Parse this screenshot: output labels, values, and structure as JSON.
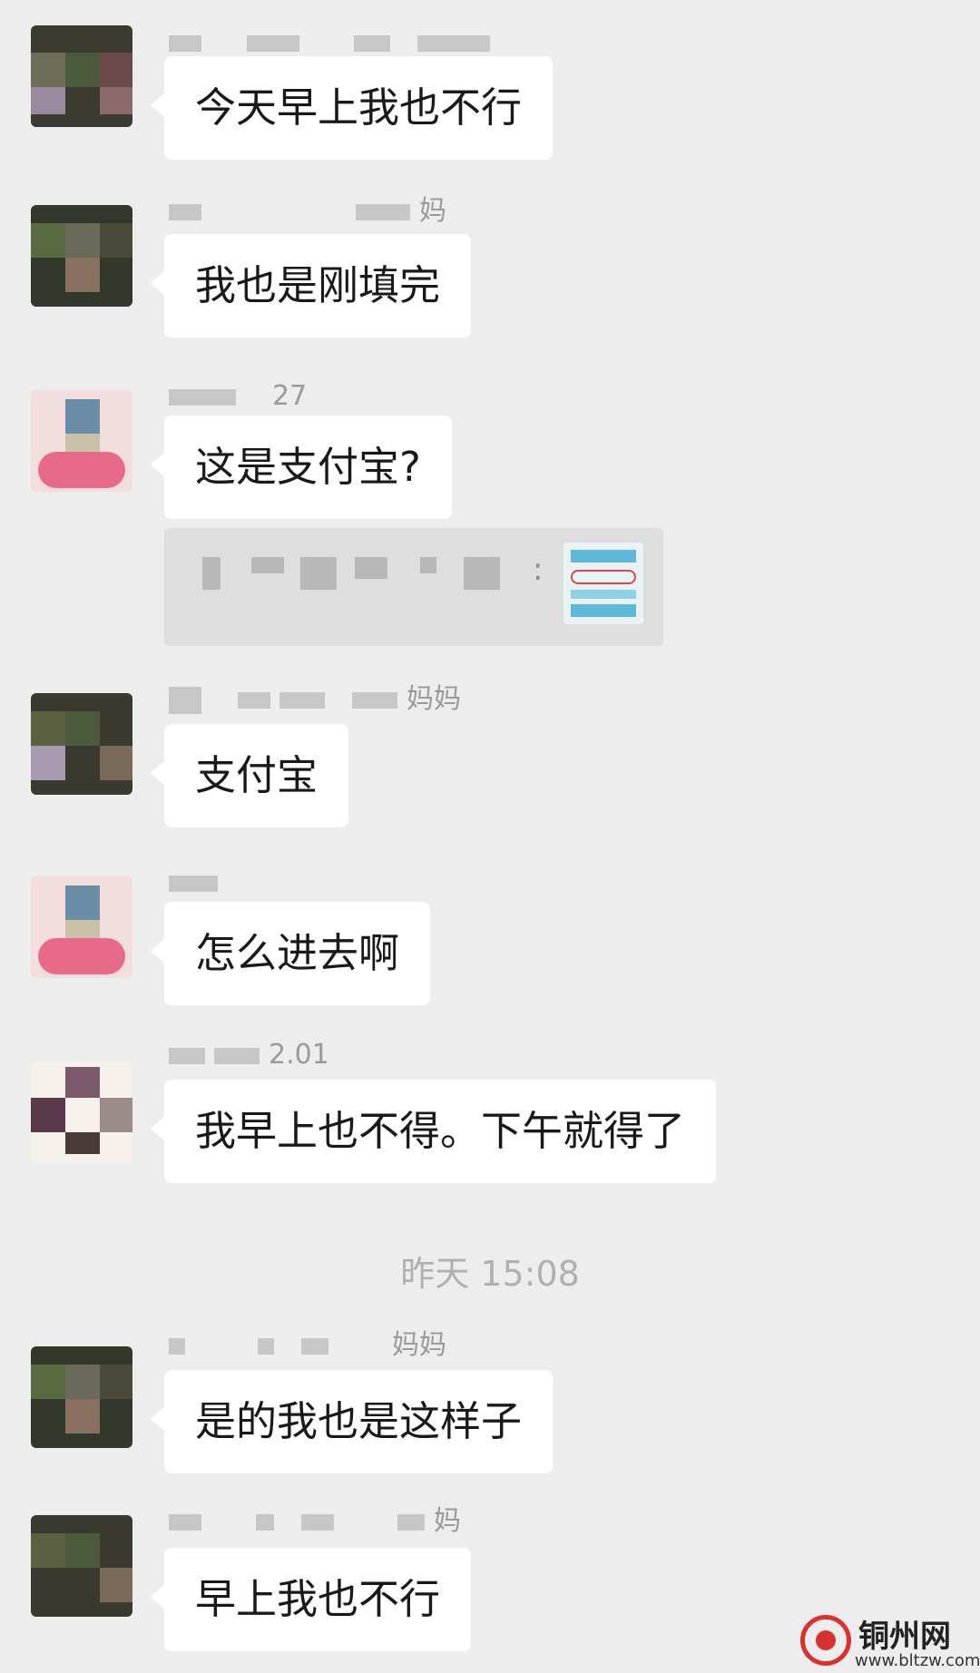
{
  "messages": [
    {
      "sender": "",
      "text": "今天早上我也不行",
      "avatar": "dark-photo"
    },
    {
      "sender": "妈",
      "text": "我也是刚填完",
      "avatar": "dark-photo"
    },
    {
      "sender": "27",
      "text": "这是支付宝?",
      "avatar": "pink-photo"
    },
    {
      "sender": "妈妈",
      "text": "支付宝",
      "avatar": "dark-photo"
    },
    {
      "sender": "",
      "text": "怎么进去啊",
      "avatar": "pink-photo"
    },
    {
      "sender": "2.01",
      "text": "我早上也不得。下午就得了",
      "avatar": "light-photo"
    },
    {
      "sender": "妈妈",
      "text": "是的我也是这样子",
      "avatar": "dark-photo"
    },
    {
      "sender": "妈",
      "text": "早上我也不行",
      "avatar": "dark-photo"
    }
  ],
  "quote": {
    "suffix": ":",
    "thumbnail": "screenshot-thumbnail"
  },
  "timestamp": "昨天 15:08",
  "watermark": {
    "name": "铜州网",
    "url": "www.bltzw.com"
  },
  "colors": {
    "background": "#ededed",
    "bubble": "#ffffff",
    "text": "#191919",
    "timestamp": "#b0b0b0",
    "watermark_red": "#d8322f"
  }
}
